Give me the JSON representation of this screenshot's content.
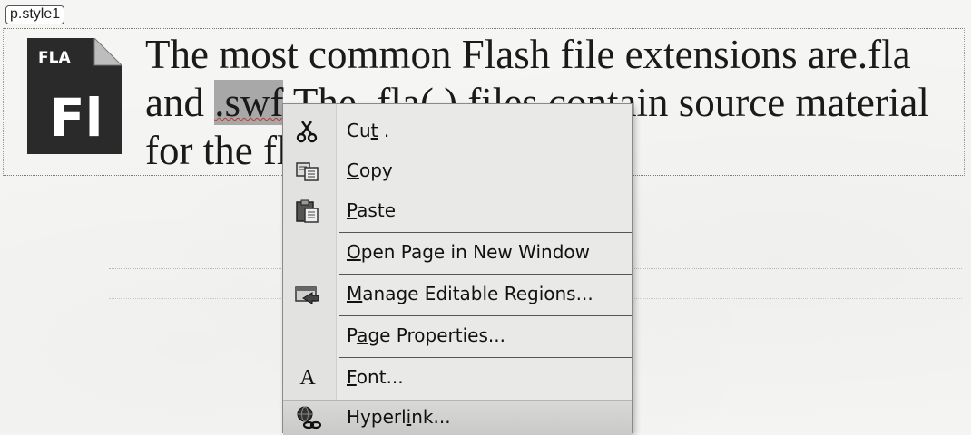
{
  "editor": {
    "style_tag": "p.style1",
    "file_icon_badge": "FLA",
    "file_icon_letters": "Fl",
    "paragraph": {
      "line1": "The most common Flash file extensions are.fla",
      "line2_pre": "and ",
      "line2_selected": ".swf",
      "line2_post": " The .fla( ) files contain source material",
      "line3": "for the fl"
    }
  },
  "context_menu": {
    "items": [
      {
        "label_pre": "Cu",
        "accel": "t",
        "label_post": " .",
        "icon": "scissors-icon"
      },
      {
        "label_pre": "",
        "accel": "C",
        "label_post": "opy",
        "icon": "copy-icon"
      },
      {
        "label_pre": "",
        "accel": "P",
        "label_post": "aste",
        "icon": "paste-icon"
      },
      {
        "label_pre": "",
        "accel": "O",
        "label_post": "pen Page in New Window",
        "icon": ""
      },
      {
        "label_pre": "",
        "accel": "M",
        "label_post": "anage Editable Regions...",
        "icon": "editable-regions-icon"
      },
      {
        "label_pre": "P",
        "accel": "a",
        "label_post": "ge Properties...",
        "icon": ""
      },
      {
        "label_pre": "",
        "accel": "F",
        "label_post": "ont...",
        "icon": "font-icon",
        "icon_glyph": "A"
      },
      {
        "label_pre": "Hyperl",
        "accel": "i",
        "label_post": "nk...",
        "icon": "hyperlink-icon"
      }
    ]
  },
  "colors": {
    "selection": "#a8a8a8",
    "menu_background": "#e9e9e8",
    "fla_icon_dark": "#2b2b2b"
  }
}
